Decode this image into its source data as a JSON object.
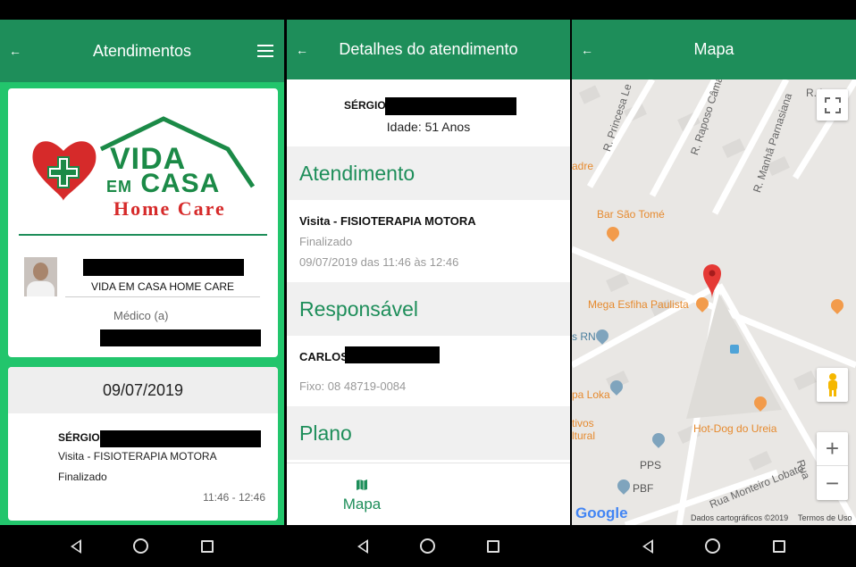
{
  "screen1": {
    "title": "Atendimentos",
    "logo": {
      "line1": "VIDA",
      "line2_small": "EM",
      "line2": "CASA",
      "line3": "Home Care"
    },
    "company": "VIDA EM CASA HOME CARE",
    "role": "Médico (a)",
    "appointment": {
      "date": "09/07/2019",
      "patient_first_name": "SÉRGIO",
      "visit": "Visita - FISIOTERAPIA MOTORA",
      "status": "Finalizado",
      "time": "11:46 - 12:46"
    }
  },
  "screen2": {
    "title": "Detalhes do atendimento",
    "patient_first_name": "SÉRGIO",
    "age": "Idade: 51 Anos",
    "section_atendimento": "Atendimento",
    "visit": "Visita - FISIOTERAPIA MOTORA",
    "status": "Finalizado",
    "datetime": "09/07/2019 das 11:46 às 12:46",
    "section_responsavel": "Responsável",
    "responsible_first_name": "CARLOS",
    "phone": "Fixo: 08 48719-0084",
    "section_plano": "Plano",
    "tab_map": "Mapa"
  },
  "screen3": {
    "title": "Mapa",
    "labels": {
      "street1": "R. Princesa Le",
      "street2": "R. Raposo Câma",
      "street3": "R. Manhã Parnasiana",
      "street4": "R. L",
      "street5": "Rua Monteiro Lobato",
      "street6": "Rua",
      "padre": "adre",
      "bar": "Bar São Tomé",
      "mega": "Mega Esfiha Paulista",
      "rn": "s RN",
      "loka": "pa Loka",
      "cultural1": "tivos",
      "cultural2": "ltural",
      "hotdog": "Hot-Dog do Ureia",
      "pps": "PPS",
      "pbf": "PBF",
      "google": "Google",
      "attribution": "Dados cartográficos ©2019",
      "terms": "Termos de Uso"
    }
  },
  "colors": {
    "primary": "#1e8e5a",
    "accent_bg": "#22c56c",
    "logo_red": "#d62a2a"
  }
}
